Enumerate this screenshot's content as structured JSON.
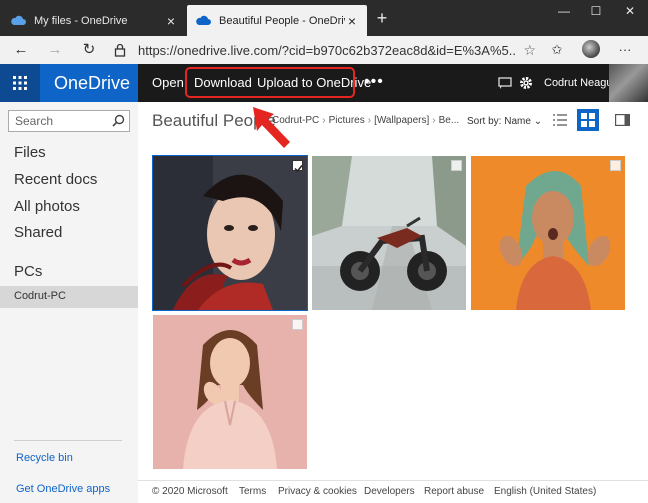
{
  "browser": {
    "tabs": [
      {
        "title": "My files - OneDrive",
        "active": false
      },
      {
        "title": "Beautiful People - OneDrive",
        "active": true
      }
    ],
    "url": "https://onedrive.live.com/?cid=b970c62b372eac8d&id=E%3A%5...",
    "new_tab": "+",
    "window_controls": {
      "minimize": "—",
      "maximize": "☐",
      "close": "✕"
    }
  },
  "header": {
    "brand": "OneDrive",
    "commands": {
      "open": "Open",
      "download": "Download",
      "upload": "Upload to OneDrive"
    },
    "more": "•••",
    "user": "Codrut Neagu",
    "accent": "#0f64c8",
    "highlight_color": "#e52620"
  },
  "leftnav": {
    "search_placeholder": "Search",
    "items": {
      "files": "Files",
      "recent": "Recent docs",
      "photos": "All photos",
      "shared": "Shared"
    },
    "pcs_heading": "PCs",
    "pc_selected": "Codrut-PC",
    "recycle": "Recycle bin",
    "get_apps": "Get OneDrive apps"
  },
  "main": {
    "title": "Beautiful People",
    "breadcrumb": [
      "Codrut-PC",
      "Pictures",
      "[Wallpapers]",
      "Be..."
    ],
    "sort_label": "Sort by: Name",
    "photos": [
      {
        "name": "woman-red-feathers",
        "selected": true
      },
      {
        "name": "motorcycle-road",
        "selected": false
      },
      {
        "name": "woman-green-hair-orange",
        "selected": false
      },
      {
        "name": "woman-pink-blouse",
        "selected": false
      }
    ]
  },
  "footer": {
    "copyright": "© 2020 Microsoft",
    "terms": "Terms",
    "privacy": "Privacy & cookies",
    "developers": "Developers",
    "report": "Report abuse",
    "language": "English (United States)"
  }
}
